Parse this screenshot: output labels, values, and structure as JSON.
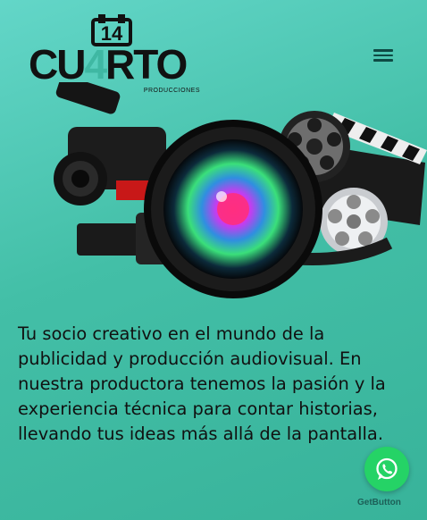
{
  "header": {
    "logo": {
      "mark": "14",
      "brand_prefix": "CU",
      "brand_highlight": "4",
      "brand_suffix": "RTO",
      "subtitle": "PRODUCCIONES"
    },
    "menu_icon": "hamburger-menu-icon"
  },
  "hero": {
    "image_subject": "camera-lens-film-reel-clapperboard-montage"
  },
  "intro": {
    "text": "Tu socio creativo en el mundo de la publicidad y producción audiovisual. En nuestra productora tenemos la pasión y la experiencia técnica para contar historias, llevando tus ideas más allá de la pantalla."
  },
  "whatsapp": {
    "icon": "whatsapp-icon",
    "label": "GetButton",
    "color": "#25d366"
  },
  "colors": {
    "background": "#43bfa7",
    "accent": "#3fb8a3"
  }
}
